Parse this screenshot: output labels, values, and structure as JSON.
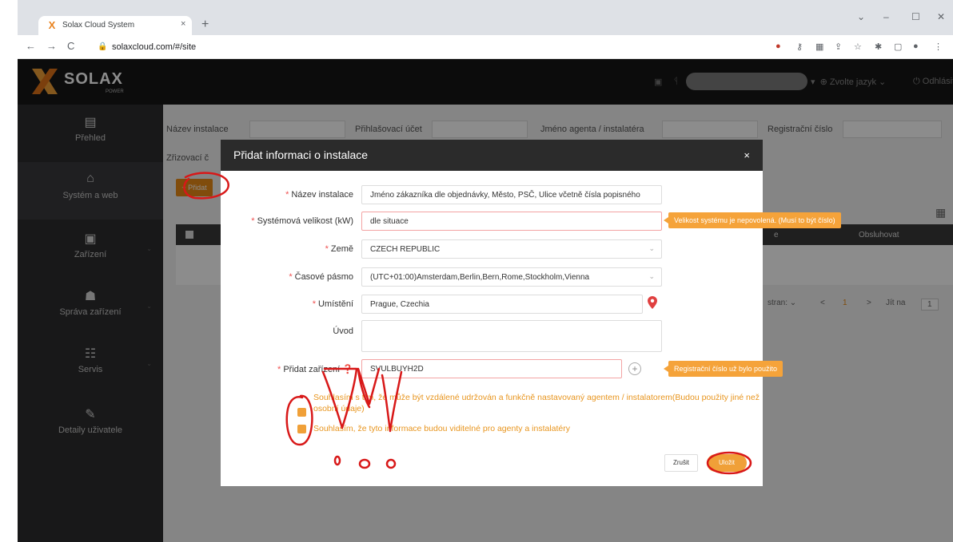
{
  "browser": {
    "tab_title": "Solax Cloud System",
    "tab_close": "×",
    "new_tab": "+",
    "address": "solaxcloud.com/#/site",
    "window_controls": [
      "⌄",
      "–",
      "☐",
      "✕"
    ]
  },
  "header": {
    "logo_text": "SOLAX",
    "logo_sub": "POWER",
    "language": "Zvolte jazyk",
    "logout": "Odhlásit se"
  },
  "sidebar": {
    "items": [
      {
        "label": "Přehled",
        "icon": "document-icon",
        "glyph": "▤"
      },
      {
        "label": "Systém a web",
        "icon": "home-icon",
        "glyph": "⌂"
      },
      {
        "label": "Zařízení",
        "icon": "device-icon",
        "glyph": "▣"
      },
      {
        "label": "Správa zařízení",
        "icon": "management-icon",
        "glyph": "☗"
      },
      {
        "label": "Servis",
        "icon": "service-icon",
        "glyph": "☷"
      },
      {
        "label": "Detaily uživatele",
        "icon": "edit-user-icon",
        "glyph": "✎"
      }
    ]
  },
  "filters": {
    "installation_name": "Název instalace",
    "login_account": "Přihlašovací účet",
    "agent_name": "Jméno agenta / instalatéra",
    "registration_number": "Registrační číslo",
    "established": "Zřizovací č"
  },
  "main": {
    "add_button": "+ Přidat",
    "table_header_state": "e",
    "table_header_actions": "Obsluhovat",
    "pager_page_size": "stran:",
    "pager_current": "1",
    "pager_goto": "Jít na",
    "pager_goto_value": "1"
  },
  "modal": {
    "title": "Přidat informaci o instalace",
    "close": "×",
    "fields": {
      "installation_name": {
        "label": "Název instalace",
        "value": "Jméno zákazníka dle objednávky, Město, PSČ, Ulice včetně čísla popisného"
      },
      "system_size": {
        "label": "Systémová velikost (kW)",
        "value": "dle situace",
        "error": "Velikost systému je nepovolená. (Musí to být číslo)"
      },
      "country": {
        "label": "Země",
        "value": "CZECH REPUBLIC"
      },
      "timezone": {
        "label": "Časové pásmo",
        "value": "(UTC+01:00)Amsterdam,Berlin,Bern,Rome,Stockholm,Vienna"
      },
      "location": {
        "label": "Umístění",
        "value": "Prague, Czechia"
      },
      "intro": {
        "label": "Úvod",
        "value": ""
      },
      "add_device": {
        "label": "Přidat zařízení",
        "value": "SVULBUYH2D",
        "error": "Registrační číslo už bylo použito"
      }
    },
    "consent_1": "Souhlasím s tím, že může být vzdálené udržován a funkčně nastavovaný agentem / instalatorem(Budou použity jiné než osobní údaje)",
    "consent_2": "Souhlasím, že tyto informace budou viditelné pro agenty a instalatéry",
    "cancel": "Zrušit",
    "save": "Uložit"
  },
  "colors": {
    "accent": "#f0a038",
    "header_bg": "#161616",
    "sidebar_bg": "#2c2c2e",
    "annotation": "#d81818"
  }
}
